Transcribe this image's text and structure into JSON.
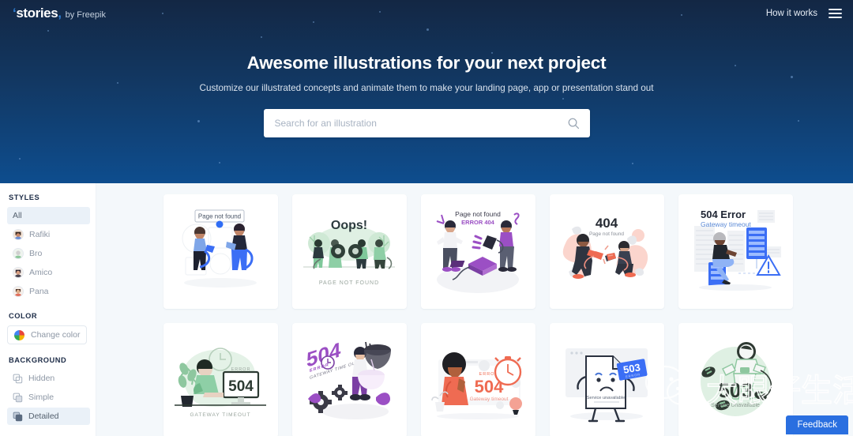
{
  "header": {
    "logo_main": "stories",
    "logo_by": "by Freepik",
    "how_it_works": "How it works",
    "menu_icon": "hamburger-menu-icon"
  },
  "hero": {
    "title": "Awesome illustrations for your next project",
    "subtitle": "Customize our illustrated concepts and animate them to make your landing page, app or presentation stand out",
    "search_placeholder": "Search for an illustration",
    "search_value": "",
    "search_icon": "search-icon",
    "bg_top": "#132744",
    "bg_bottom": "#0e4d8e"
  },
  "sidebar": {
    "styles_title": "STYLES",
    "styles": [
      {
        "label": "All",
        "active": true,
        "has_avatar": false
      },
      {
        "label": "Rafiki",
        "active": false,
        "has_avatar": true
      },
      {
        "label": "Bro",
        "active": false,
        "has_avatar": true
      },
      {
        "label": "Amico",
        "active": false,
        "has_avatar": true
      },
      {
        "label": "Pana",
        "active": false,
        "has_avatar": true
      }
    ],
    "color_title": "COLOR",
    "color_button": "Change color",
    "color_icon": "color-wheel-icon",
    "background_title": "BACKGROUND",
    "backgrounds": [
      {
        "label": "Hidden",
        "active": false,
        "icon": "layers-hidden-icon"
      },
      {
        "label": "Simple",
        "active": false,
        "icon": "layers-simple-icon"
      },
      {
        "label": "Detailed",
        "active": true,
        "icon": "layers-detailed-icon"
      }
    ]
  },
  "gallery": {
    "cards": [
      {
        "id": "page-not-found-rafiki",
        "title": "Page not found",
        "subtitle": "",
        "accent": "#3b6ef5",
        "theme": "blue"
      },
      {
        "id": "oops-page-not-found-green",
        "title": "Oops!",
        "subtitle": "PAGE NOT FOUND",
        "accent": "#6cbf8a",
        "theme": "green"
      },
      {
        "id": "page-not-found-error-404-purple",
        "title": "Page not found",
        "subtitle": "ERROR 404",
        "accent": "#8b3fbd",
        "theme": "purple"
      },
      {
        "id": "404-page-not-found-coral",
        "title": "404",
        "subtitle": "Page not found",
        "accent": "#f4998a",
        "theme": "coral"
      },
      {
        "id": "504-error-gateway-timeout-blue",
        "title": "504 Error",
        "subtitle": "Gateway timeout",
        "accent": "#3b6ef5",
        "theme": "blue"
      },
      {
        "id": "error-504-gateway-timeout-green",
        "title": "504",
        "subtitle": "GATEWAY TIMEOUT",
        "label": "ERROR",
        "accent": "#6cbf8a",
        "theme": "green"
      },
      {
        "id": "504-error-gateway-time-out-purple",
        "title": "504",
        "subtitle": "GATEWAY TIME OUT",
        "label": "ERROR",
        "accent": "#8b3fbd",
        "theme": "purple"
      },
      {
        "id": "error-504-gateway-timeout-coral",
        "title": "504",
        "subtitle": "Gateway timeout",
        "label": "ERROR",
        "accent": "#ef6b52",
        "theme": "coral"
      },
      {
        "id": "503-service-unavailable-blue",
        "title": "503",
        "subtitle": "Service unavailable",
        "label": "ERROR",
        "accent": "#3b6ef5",
        "theme": "blue"
      },
      {
        "id": "503-service-unavailable-green",
        "title": "503",
        "subtitle": "Service Unavailable",
        "accent": "#6cbf8a",
        "theme": "green"
      }
    ]
  },
  "watermark": {
    "text": "大眼仔生活圈",
    "icon": "wechat-icon"
  },
  "feedback": {
    "label": "Feedback",
    "color": "#2a6fe0"
  }
}
